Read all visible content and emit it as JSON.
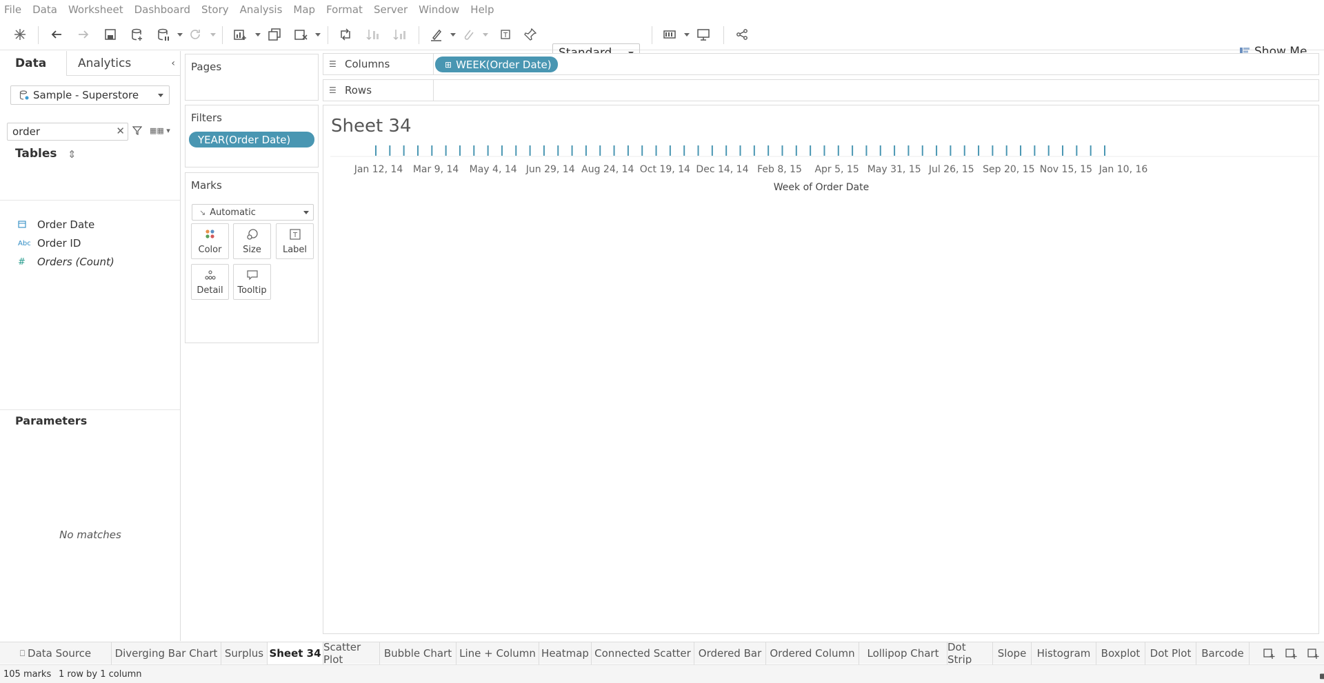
{
  "menu": [
    "File",
    "Data",
    "Worksheet",
    "Dashboard",
    "Story",
    "Analysis",
    "Map",
    "Format",
    "Server",
    "Window",
    "Help"
  ],
  "toolbar": {
    "fit_value": "Standard",
    "show_me_label": "Show Me"
  },
  "data_pane": {
    "tab_data": "Data",
    "tab_analytics": "Analytics",
    "datasource": "Sample - Superstore",
    "search_value": "order",
    "tables_header": "Tables",
    "fields": [
      {
        "label": "Order Date",
        "type": "date-icon"
      },
      {
        "label": "Order ID",
        "type": "abc-icon",
        "icon_text": "Abc"
      },
      {
        "label": "Orders (Count)",
        "type": "measure-icon",
        "icon_text": "#"
      }
    ],
    "parameters_header": "Parameters",
    "no_matches": "No matches"
  },
  "pages_card": {
    "title": "Pages"
  },
  "filters_card": {
    "title": "Filters",
    "pill": "YEAR(Order Date)"
  },
  "marks_card": {
    "title": "Marks",
    "mark_type": "Automatic",
    "buttons": [
      "Color",
      "Size",
      "Label",
      "Detail",
      "Tooltip"
    ]
  },
  "shelves": {
    "columns_label": "Columns",
    "columns_pill": "WEEK(Order Date)",
    "rows_label": "Rows"
  },
  "view": {
    "sheet_title": "Sheet 34"
  },
  "chart_data": {
    "type": "strip",
    "mark_count": 105,
    "xlabel": "Week of Order Date",
    "x_tick_labels": [
      "Jan 12, 14",
      "Mar 9, 14",
      "May 4, 14",
      "Jun 29, 14",
      "Aug 24, 14",
      "Oct 19, 14",
      "Dec 14, 14",
      "Feb 8, 15",
      "Apr 5, 15",
      "May 31, 15",
      "Jul 26, 15",
      "Sep 20, 15",
      "Nov 15, 15",
      "Jan 10, 16"
    ],
    "x_range": [
      "Jan 5, 14",
      "Dec 27, 15"
    ],
    "mark_color": "#4996b2"
  },
  "sheet_tabs": [
    {
      "label": "Data Source",
      "active": false
    },
    {
      "label": "Diverging Bar Chart",
      "active": false
    },
    {
      "label": "Surplus",
      "active": false
    },
    {
      "label": "Sheet 34",
      "active": true
    },
    {
      "label": "Scatter Plot",
      "active": false
    },
    {
      "label": "Bubble Chart",
      "active": false
    },
    {
      "label": "Line + Column",
      "active": false
    },
    {
      "label": "Heatmap",
      "active": false
    },
    {
      "label": "Connected Scatter",
      "active": false
    },
    {
      "label": "Ordered Bar",
      "active": false
    },
    {
      "label": "Ordered Column",
      "active": false
    },
    {
      "label": "Lollipop Chart",
      "active": false
    },
    {
      "label": "Dot Strip",
      "active": false
    },
    {
      "label": "Slope",
      "active": false
    },
    {
      "label": "Histogram",
      "active": false
    },
    {
      "label": "Boxplot",
      "active": false
    },
    {
      "label": "Dot Plot",
      "active": false
    },
    {
      "label": "Barcode",
      "active": false
    }
  ],
  "status": {
    "marks": "105 marks",
    "layout": "1 row by 1 column"
  }
}
